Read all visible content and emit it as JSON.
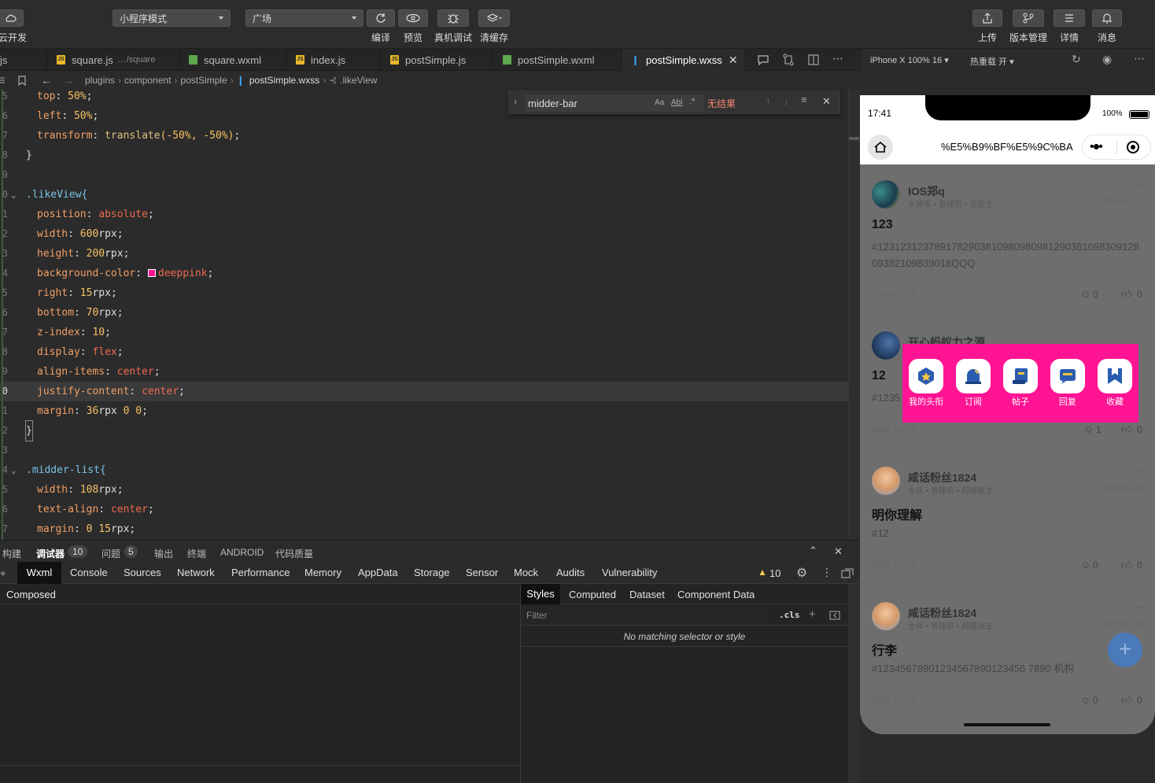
{
  "toolbar": {
    "cloud_label": "云开发",
    "mode_select": "小程序模式",
    "page_select": "广场",
    "compile": "编译",
    "preview": "预览",
    "remote_debug": "真机调试",
    "clear_cache": "清缓存",
    "upload": "上传",
    "version": "版本管理",
    "details": "详情",
    "messages": "消息"
  },
  "tabs": [
    {
      "label": "js",
      "icon": "js"
    },
    {
      "label": "square.js",
      "hint": "…/square",
      "icon": "js"
    },
    {
      "label": "square.wxml",
      "icon": "wxml"
    },
    {
      "label": "index.js",
      "icon": "js"
    },
    {
      "label": "postSimple.js",
      "icon": "js"
    },
    {
      "label": "postSimple.wxml",
      "icon": "wxml"
    },
    {
      "label": "postSimple.wxss",
      "icon": "wxss"
    }
  ],
  "breadcrumb": [
    "plugins",
    "component",
    "postSimple",
    "postSimple.wxss",
    ".likeView"
  ],
  "find": {
    "query": "midder-bar",
    "result": "无结果",
    "case": "Aa",
    "word": "Abl",
    "regex": ".*"
  },
  "code": {
    "l1": {
      "prop": "top",
      "val": "50%"
    },
    "l2": {
      "prop": "left",
      "val": "50%"
    },
    "l3": {
      "prop": "transform",
      "fn": "translate",
      "val": "(-50%, -50%)"
    },
    "l4": "}",
    "l6": ".likeView{",
    "l7": {
      "prop": "position",
      "val": "absolute"
    },
    "l8": {
      "prop": "width",
      "val": "600",
      "unit": "rpx"
    },
    "l9": {
      "prop": "height",
      "val": "200",
      "unit": "rpx"
    },
    "l10": {
      "prop": "background-color",
      "val": "deeppink"
    },
    "l11": {
      "prop": "right",
      "val": "15",
      "unit": "rpx"
    },
    "l12": {
      "prop": "bottom",
      "val": "70",
      "unit": "rpx"
    },
    "l13": {
      "prop": "z-index",
      "val": "10"
    },
    "l14": {
      "prop": "display",
      "val": "flex"
    },
    "l15": {
      "prop": "align-items",
      "val": "center"
    },
    "l16": {
      "prop": "justify-content",
      "val": "center"
    },
    "l17": {
      "prop": "margin",
      "val": "36",
      "unit": "rpx",
      "rest": "0 0"
    },
    "l18": "}",
    "l20": ".midder-list{",
    "l21": {
      "prop": "width",
      "val": "108",
      "unit": "rpx"
    },
    "l22": {
      "prop": "text-align",
      "val": "center"
    },
    "l23": {
      "prop": "margin",
      "val": "0",
      "rest": "15",
      "unit": "rpx"
    },
    "gutter": [
      "5",
      "6",
      "7",
      "8",
      "9",
      "0",
      "1",
      "2",
      "3",
      "4",
      "5",
      "6",
      "7",
      "8",
      "9",
      "0",
      "1",
      "2",
      "3",
      "4",
      "5",
      "6",
      "7"
    ]
  },
  "panel": {
    "build": "构建",
    "debugger": "调试器",
    "debugger_count": "10",
    "issues": "问题",
    "issues_count": "5",
    "output": "输出",
    "terminal": "终端",
    "android": "ANDROID",
    "quality": "代码质量"
  },
  "devtools": {
    "tabs": [
      "Wxml",
      "Console",
      "Sources",
      "Network",
      "Performance",
      "Memory",
      "AppData",
      "Storage",
      "Sensor",
      "Mock",
      "Audits",
      "Vulnerability"
    ],
    "warnings": "10",
    "composed": "Composed",
    "style_tabs": [
      "Styles",
      "Computed",
      "Dataset",
      "Component Data"
    ],
    "filter_placeholder": "Filter",
    "cls": ".cls",
    "no_match": "No matching selector or style"
  },
  "sim": {
    "device": "iPhone X 100% 16",
    "hotreload": "热重载 开",
    "time": "17:41",
    "battery": "100%",
    "nav_title": "%E5%B9%BF%E5%9C%BA",
    "posts": [
      {
        "user": "IOS郑q",
        "meta": "大将军 • 管理员 • 总版主",
        "date": "2025-02-13",
        "title": "123",
        "body": "#123123123789178290381098098098129038109830912809382109839018QQQ",
        "pdate": "2025-02-13",
        "comments": "0",
        "likes": "0"
      },
      {
        "user": "开心蚂蚁力之源",
        "meta": "",
        "date": "",
        "title": "12",
        "body": "#1235",
        "pdate": "2025-02-13",
        "comments": "1",
        "likes": "0"
      },
      {
        "user": "咸话粉丝1824",
        "meta": "士兵 • 管理员 • 超级版主",
        "date": "2025-02-13",
        "title": "明你理解",
        "body": "#12",
        "pdate": "2025-02-13",
        "comments": "0",
        "likes": "0"
      },
      {
        "user": "咸话粉丝1824",
        "meta": "士兵 • 管理员 • 超级版主",
        "date": "2025-02-13",
        "title": "行李",
        "body": "#12345678901234567890123456 7890 机构",
        "pdate": "2025-02-13",
        "comments": "0",
        "likes": "0"
      }
    ],
    "likeview": [
      "我的头衔",
      "订阅",
      "帖子",
      "回复",
      "收藏"
    ]
  },
  "colors": {
    "deeppink": "#ff1493",
    "accent": "#3da9fc"
  }
}
